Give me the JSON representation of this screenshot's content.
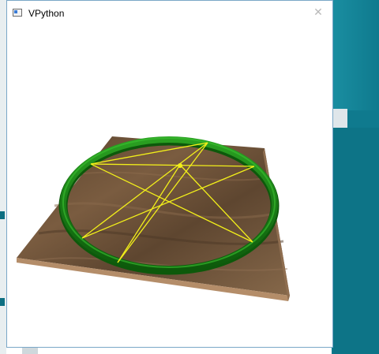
{
  "window": {
    "title": "VPython",
    "close_glyph": "✕",
    "icon": "app-window-icon"
  },
  "scene": {
    "description": "",
    "colors": {
      "table_top": "#6e5238",
      "table_edge": "#a07c5c",
      "ring": "#1c8a18",
      "ring_dark": "#0e5f0c",
      "lines": "#f2ef1a",
      "desktop": "#0f7a8e"
    }
  }
}
